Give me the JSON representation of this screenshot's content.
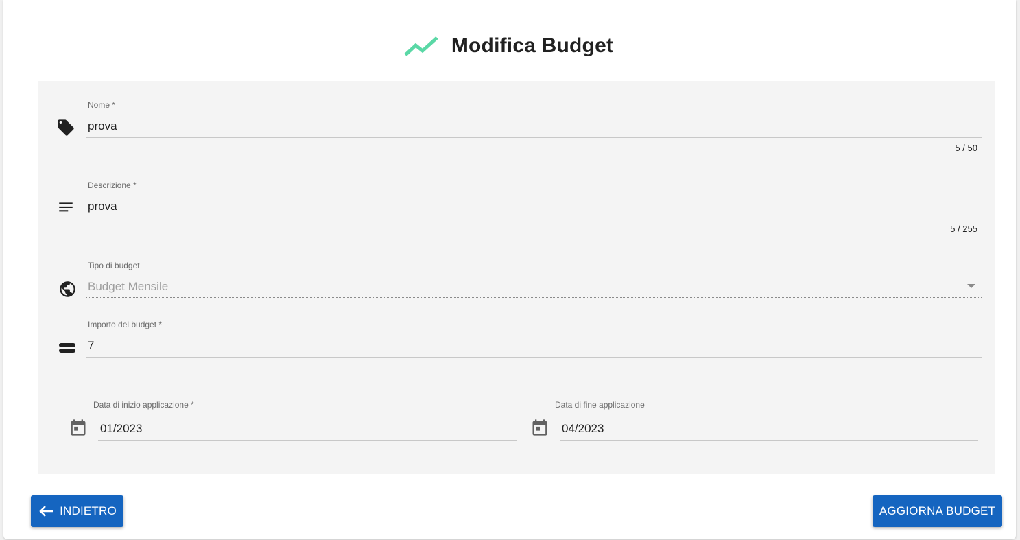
{
  "page": {
    "title": "Modifica Budget",
    "title_icon": "trending-up-icon",
    "accent_color": "#5ad8a6"
  },
  "form": {
    "nome": {
      "label": "Nome *",
      "value": "prova",
      "counter": "5 / 50",
      "icon": "tag-icon"
    },
    "descrizione": {
      "label": "Descrizione *",
      "value": "prova",
      "counter": "5 / 255",
      "icon": "notes-icon"
    },
    "tipo_budget": {
      "label": "Tipo di budget",
      "value": "Budget Mensile",
      "icon": "globe-icon",
      "disabled": true
    },
    "importo": {
      "label": "Importo del budget *",
      "value": "7",
      "icon": "money-icon"
    },
    "data_inizio": {
      "label": "Data di inizio applicazione *",
      "value": "01/2023",
      "icon": "calendar-icon"
    },
    "data_fine": {
      "label": "Data di fine applicazione",
      "value": "04/2023",
      "icon": "calendar-icon"
    }
  },
  "actions": {
    "back_label": "INDIETRO",
    "submit_label": "AGGIORNA BUDGET",
    "primary_color": "#1565c0"
  }
}
